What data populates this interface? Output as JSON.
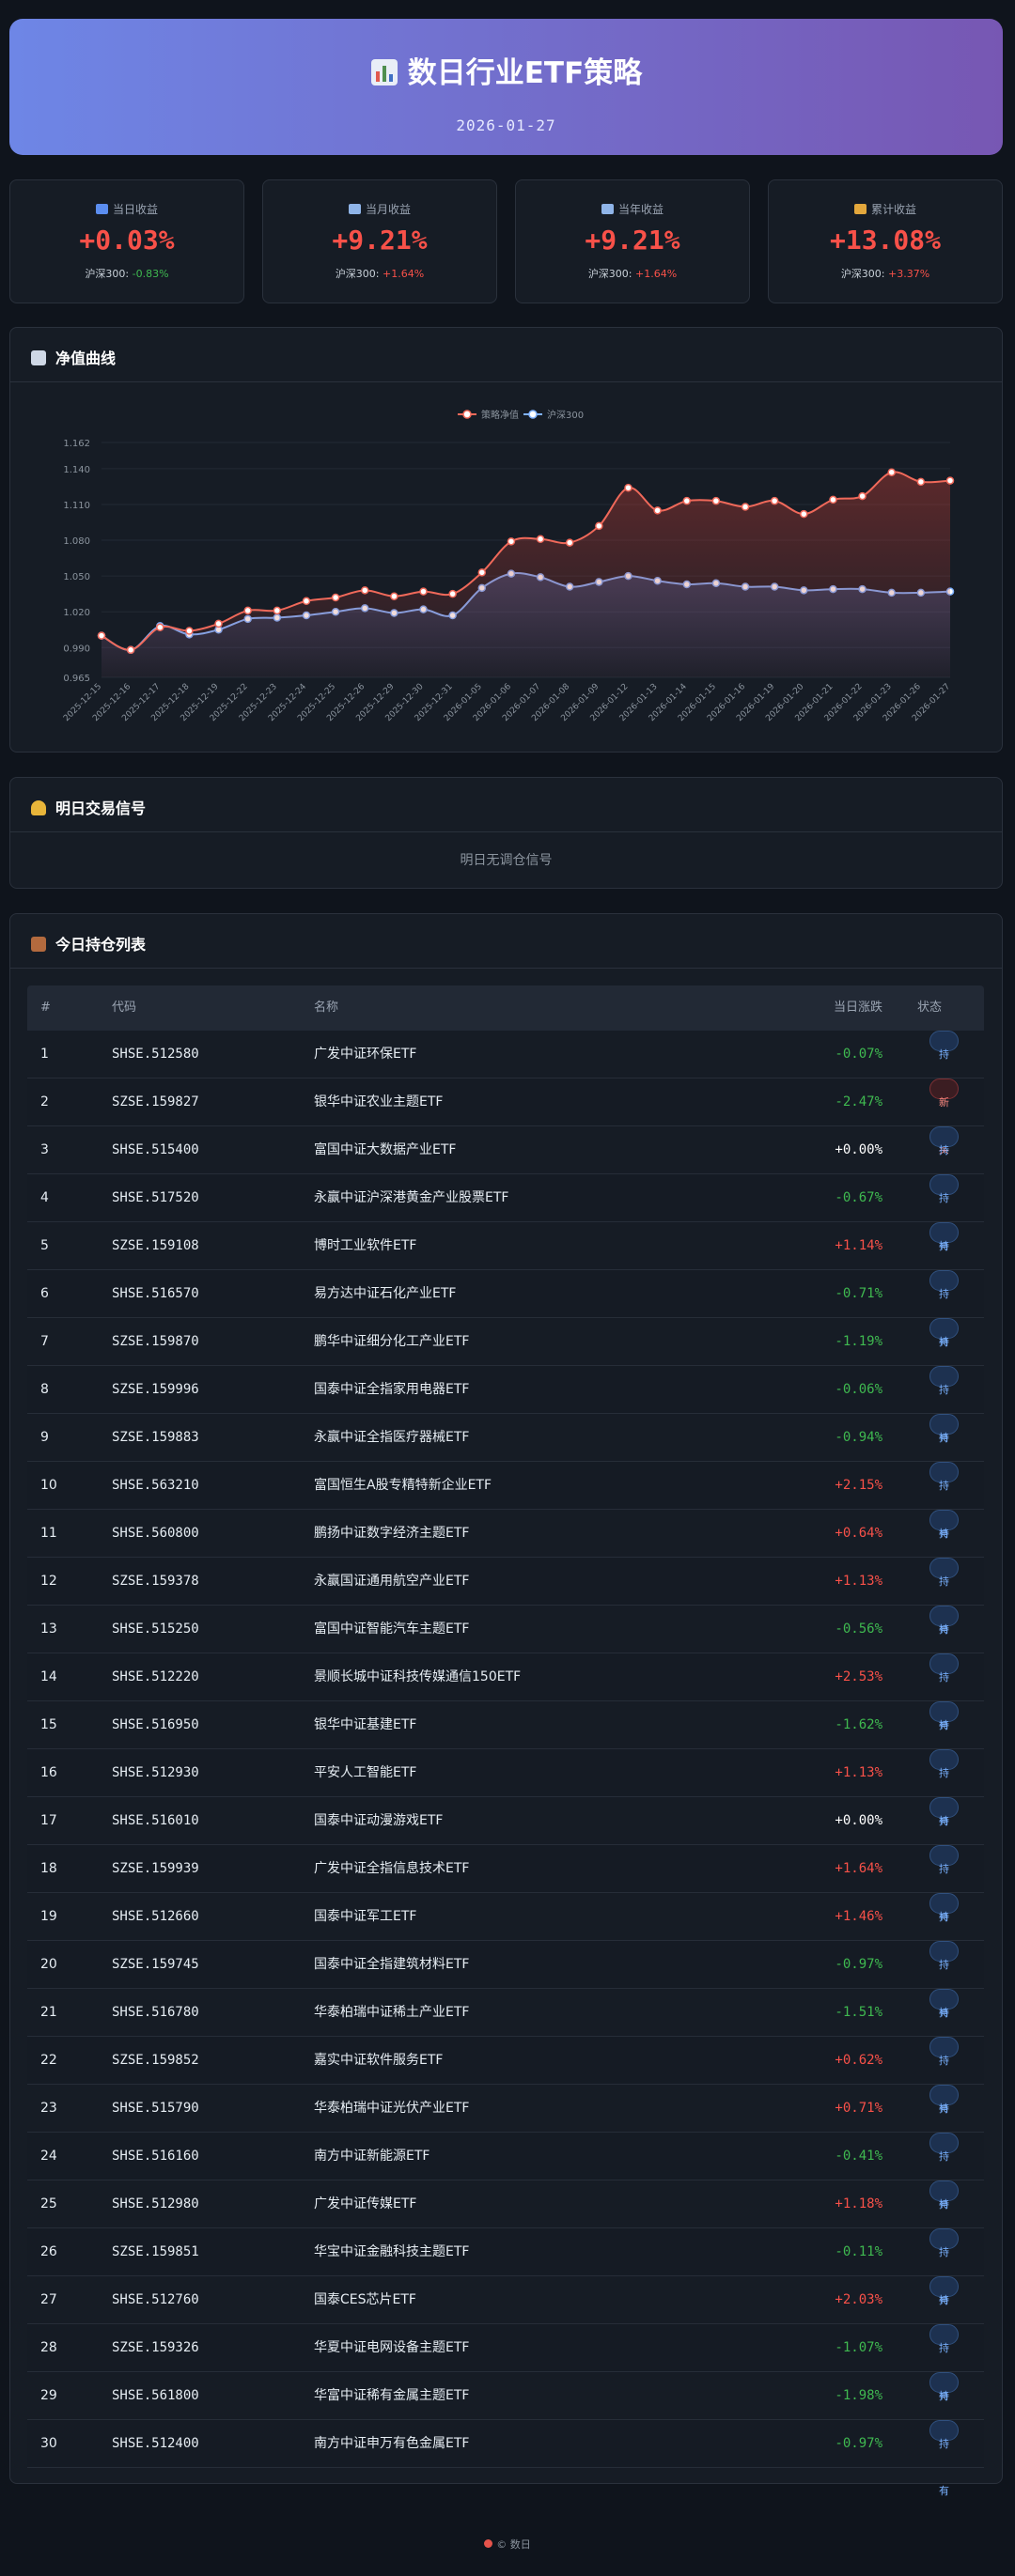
{
  "header": {
    "title": "数日行业ETF策略",
    "date": "2026-01-27"
  },
  "stats": [
    {
      "label": "当日收益",
      "value": "+0.03%",
      "bench_label": "沪深300:",
      "bench_value": "-0.83%",
      "bench_sign": "neg",
      "icon": "chart-icon",
      "icon_color": "#5b8def"
    },
    {
      "label": "当月收益",
      "value": "+9.21%",
      "bench_label": "沪深300:",
      "bench_value": "+1.64%",
      "bench_sign": "pos",
      "icon": "calendar-icon",
      "icon_color": "#8fb4e8"
    },
    {
      "label": "当年收益",
      "value": "+9.21%",
      "bench_label": "沪深300:",
      "bench_value": "+1.64%",
      "bench_sign": "pos",
      "icon": "calendar-icon",
      "icon_color": "#8fb4e8"
    },
    {
      "label": "累计收益",
      "value": "+13.08%",
      "bench_label": "沪深300:",
      "bench_value": "+3.37%",
      "bench_sign": "pos",
      "icon": "trophy-icon",
      "icon_color": "#e3a73c"
    }
  ],
  "nav_section": {
    "title": "净值曲线",
    "icon": "chart-icon"
  },
  "chart_data": {
    "type": "line",
    "title": "",
    "xlabel": "",
    "ylabel": "",
    "legend_position": "top-center",
    "ylim": [
      0.965,
      1.162
    ],
    "yticks": [
      "1.162",
      "1.140",
      "1.110",
      "1.080",
      "1.050",
      "1.020",
      "0.990",
      "0.965"
    ],
    "ytick_values": [
      1.162,
      1.14,
      1.11,
      1.08,
      1.05,
      1.02,
      0.99,
      0.965
    ],
    "x": [
      "2025-12-15",
      "2025-12-16",
      "2025-12-17",
      "2025-12-18",
      "2025-12-19",
      "2025-12-22",
      "2025-12-23",
      "2025-12-24",
      "2025-12-25",
      "2025-12-26",
      "2025-12-29",
      "2025-12-30",
      "2025-12-31",
      "2026-01-05",
      "2026-01-06",
      "2026-01-07",
      "2026-01-08",
      "2026-01-09",
      "2026-01-12",
      "2026-01-13",
      "2026-01-14",
      "2026-01-15",
      "2026-01-16",
      "2026-01-19",
      "2026-01-20",
      "2026-01-21",
      "2026-01-22",
      "2026-01-23",
      "2026-01-26",
      "2026-01-27"
    ],
    "series": [
      {
        "name": "策略净值",
        "color": "#f0695a",
        "values": [
          1.0,
          0.988,
          1.007,
          1.004,
          1.01,
          1.021,
          1.021,
          1.029,
          1.032,
          1.038,
          1.033,
          1.037,
          1.035,
          1.053,
          1.079,
          1.081,
          1.078,
          1.092,
          1.124,
          1.105,
          1.113,
          1.113,
          1.108,
          1.113,
          1.102,
          1.114,
          1.117,
          1.137,
          1.129,
          1.13
        ]
      },
      {
        "name": "沪深300",
        "color": "#7fb2ff",
        "values": [
          1.0,
          0.988,
          1.008,
          1.001,
          1.005,
          1.014,
          1.015,
          1.017,
          1.02,
          1.023,
          1.019,
          1.022,
          1.017,
          1.04,
          1.052,
          1.049,
          1.041,
          1.045,
          1.05,
          1.046,
          1.043,
          1.044,
          1.041,
          1.041,
          1.038,
          1.039,
          1.039,
          1.036,
          1.036,
          1.037
        ]
      }
    ]
  },
  "signal_section": {
    "title": "明日交易信号",
    "icon": "bell-icon",
    "message": "明日无调仓信号"
  },
  "holdings_section": {
    "title": "今日持仓列表",
    "icon": "briefcase-icon",
    "columns": [
      "#",
      "代码",
      "名称",
      "当日涨跌",
      "状态"
    ],
    "rows": [
      {
        "idx": "1",
        "code": "SHSE.512580",
        "name": "广发中证环保ETF",
        "change": "-0.07%",
        "sign": "neg",
        "status": "持有",
        "buy": false
      },
      {
        "idx": "2",
        "code": "SZSE.159827",
        "name": "银华中证农业主题ETF",
        "change": "-2.47%",
        "sign": "neg",
        "status": "新买入",
        "buy": true
      },
      {
        "idx": "3",
        "code": "SHSE.515400",
        "name": "富国中证大数据产业ETF",
        "change": "+0.00%",
        "sign": "zero",
        "status": "持有",
        "buy": false
      },
      {
        "idx": "4",
        "code": "SHSE.517520",
        "name": "永赢中证沪深港黄金产业股票ETF",
        "change": "-0.67%",
        "sign": "neg",
        "status": "持有",
        "buy": false
      },
      {
        "idx": "5",
        "code": "SZSE.159108",
        "name": "博时工业软件ETF",
        "change": "+1.14%",
        "sign": "pos",
        "status": "持有",
        "buy": false
      },
      {
        "idx": "6",
        "code": "SHSE.516570",
        "name": "易方达中证石化产业ETF",
        "change": "-0.71%",
        "sign": "neg",
        "status": "持有",
        "buy": false
      },
      {
        "idx": "7",
        "code": "SZSE.159870",
        "name": "鹏华中证细分化工产业ETF",
        "change": "-1.19%",
        "sign": "neg",
        "status": "持有",
        "buy": false
      },
      {
        "idx": "8",
        "code": "SZSE.159996",
        "name": "国泰中证全指家用电器ETF",
        "change": "-0.06%",
        "sign": "neg",
        "status": "持有",
        "buy": false
      },
      {
        "idx": "9",
        "code": "SZSE.159883",
        "name": "永赢中证全指医疗器械ETF",
        "change": "-0.94%",
        "sign": "neg",
        "status": "持有",
        "buy": false
      },
      {
        "idx": "10",
        "code": "SHSE.563210",
        "name": "富国恒生A股专精特新企业ETF",
        "change": "+2.15%",
        "sign": "pos",
        "status": "持有",
        "buy": false
      },
      {
        "idx": "11",
        "code": "SHSE.560800",
        "name": "鹏扬中证数字经济主题ETF",
        "change": "+0.64%",
        "sign": "pos",
        "status": "持有",
        "buy": false
      },
      {
        "idx": "12",
        "code": "SZSE.159378",
        "name": "永赢国证通用航空产业ETF",
        "change": "+1.13%",
        "sign": "pos",
        "status": "持有",
        "buy": false
      },
      {
        "idx": "13",
        "code": "SHSE.515250",
        "name": "富国中证智能汽车主题ETF",
        "change": "-0.56%",
        "sign": "neg",
        "status": "持有",
        "buy": false
      },
      {
        "idx": "14",
        "code": "SHSE.512220",
        "name": "景顺长城中证科技传媒通信150ETF",
        "change": "+2.53%",
        "sign": "pos",
        "status": "持有",
        "buy": false
      },
      {
        "idx": "15",
        "code": "SHSE.516950",
        "name": "银华中证基建ETF",
        "change": "-1.62%",
        "sign": "neg",
        "status": "持有",
        "buy": false
      },
      {
        "idx": "16",
        "code": "SHSE.512930",
        "name": "平安人工智能ETF",
        "change": "+1.13%",
        "sign": "pos",
        "status": "持有",
        "buy": false
      },
      {
        "idx": "17",
        "code": "SHSE.516010",
        "name": "国泰中证动漫游戏ETF",
        "change": "+0.00%",
        "sign": "zero",
        "status": "持有",
        "buy": false
      },
      {
        "idx": "18",
        "code": "SZSE.159939",
        "name": "广发中证全指信息技术ETF",
        "change": "+1.64%",
        "sign": "pos",
        "status": "持有",
        "buy": false
      },
      {
        "idx": "19",
        "code": "SHSE.512660",
        "name": "国泰中证军工ETF",
        "change": "+1.46%",
        "sign": "pos",
        "status": "持有",
        "buy": false
      },
      {
        "idx": "20",
        "code": "SZSE.159745",
        "name": "国泰中证全指建筑材料ETF",
        "change": "-0.97%",
        "sign": "neg",
        "status": "持有",
        "buy": false
      },
      {
        "idx": "21",
        "code": "SHSE.516780",
        "name": "华泰柏瑞中证稀土产业ETF",
        "change": "-1.51%",
        "sign": "neg",
        "status": "持有",
        "buy": false
      },
      {
        "idx": "22",
        "code": "SZSE.159852",
        "name": "嘉实中证软件服务ETF",
        "change": "+0.62%",
        "sign": "pos",
        "status": "持有",
        "buy": false
      },
      {
        "idx": "23",
        "code": "SHSE.515790",
        "name": "华泰柏瑞中证光伏产业ETF",
        "change": "+0.71%",
        "sign": "pos",
        "status": "持有",
        "buy": false
      },
      {
        "idx": "24",
        "code": "SHSE.516160",
        "name": "南方中证新能源ETF",
        "change": "-0.41%",
        "sign": "neg",
        "status": "持有",
        "buy": false
      },
      {
        "idx": "25",
        "code": "SHSE.512980",
        "name": "广发中证传媒ETF",
        "change": "+1.18%",
        "sign": "pos",
        "status": "持有",
        "buy": false
      },
      {
        "idx": "26",
        "code": "SZSE.159851",
        "name": "华宝中证金融科技主题ETF",
        "change": "-0.11%",
        "sign": "neg",
        "status": "持有",
        "buy": false
      },
      {
        "idx": "27",
        "code": "SHSE.512760",
        "name": "国泰CES芯片ETF",
        "change": "+2.03%",
        "sign": "pos",
        "status": "持有",
        "buy": false
      },
      {
        "idx": "28",
        "code": "SZSE.159326",
        "name": "华夏中证电网设备主题ETF",
        "change": "-1.07%",
        "sign": "neg",
        "status": "持有",
        "buy": false
      },
      {
        "idx": "29",
        "code": "SHSE.561800",
        "name": "华富中证稀有金属主题ETF",
        "change": "-1.98%",
        "sign": "neg",
        "status": "持有",
        "buy": false
      },
      {
        "idx": "30",
        "code": "SHSE.512400",
        "name": "南方中证申万有色金属ETF",
        "change": "-0.97%",
        "sign": "neg",
        "status": "持有",
        "buy": false
      }
    ]
  },
  "footer": {
    "text": "© 数日",
    "icon": "pin-icon"
  }
}
